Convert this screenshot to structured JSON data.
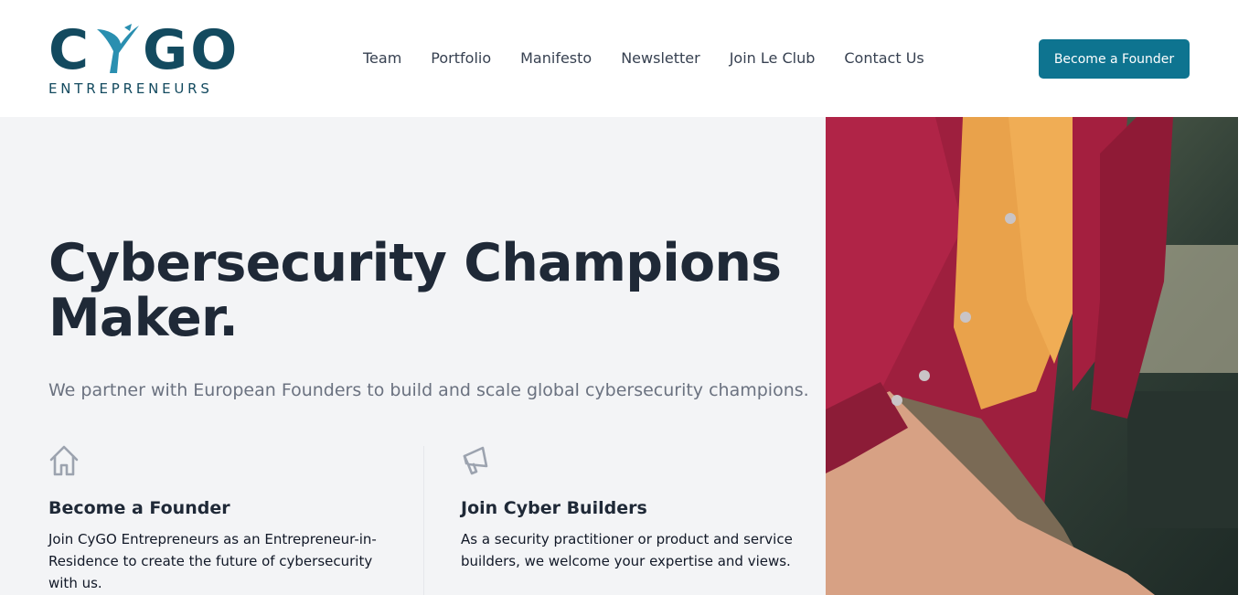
{
  "logo": {
    "main_left": "C",
    "main_right": "GO",
    "sub": "ENTREPRENEURS"
  },
  "nav": {
    "items": [
      {
        "label": "Team"
      },
      {
        "label": "Portfolio"
      },
      {
        "label": "Manifesto"
      },
      {
        "label": "Newsletter"
      },
      {
        "label": "Join Le Club"
      },
      {
        "label": "Contact Us"
      }
    ]
  },
  "header": {
    "cta_label": "Become a Founder"
  },
  "hero": {
    "title": "Cybersecurity Champions Maker.",
    "subtitle": "We partner with European Founders to build and scale global cybersecurity champions."
  },
  "features": [
    {
      "icon": "home-icon",
      "title": "Become a Founder",
      "text": "Join CyGO Entrepreneurs as an Entrepreneur-in-Residence to create the future of cybersecurity with us."
    },
    {
      "icon": "megaphone-icon",
      "title": "Join Cyber Builders",
      "text": "As a security practitioner or product and service builders, we welcome your expertise and views."
    }
  ],
  "colors": {
    "brand_dark": "#134a5f",
    "brand_accent": "#2a8fb0",
    "cta": "#0e7490",
    "hero_bg": "#f3f4f6"
  }
}
